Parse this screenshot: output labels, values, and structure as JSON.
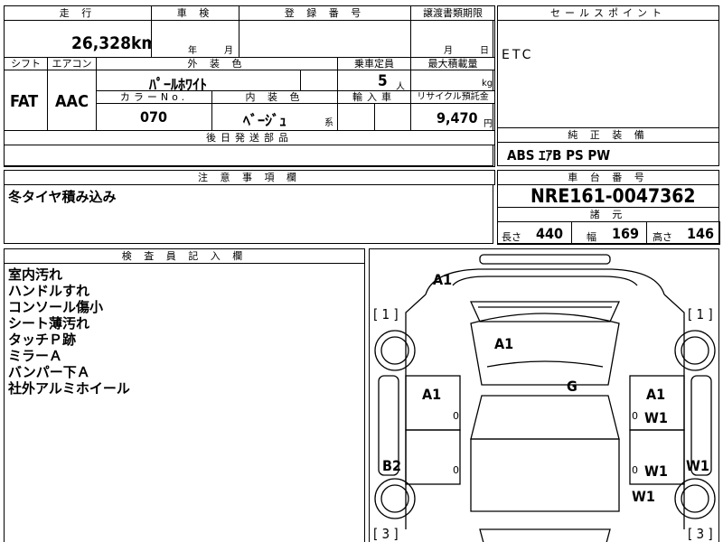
{
  "top": {
    "mileage_label": "走 行",
    "mileage_value": "26,328",
    "mileage_unit": "km",
    "inspection_label": "車 検",
    "inspection_year_unit": "年",
    "inspection_month_unit": "月",
    "registration_label": "登 録 番 号",
    "transfer_label": "譲渡書類期限",
    "transfer_month_unit": "月",
    "transfer_day_unit": "日",
    "sales_point_label": "セールスポイント",
    "sales_point_value": "ETC"
  },
  "row2": {
    "shift_label": "シフト",
    "shift_value": "FAT",
    "aircon_label": "エアコン",
    "aircon_value": "AAC",
    "exterior_label": "外 装 色",
    "exterior_value": "ﾊﾟｰﾙﾎﾜｲﾄ",
    "capacity_label": "乗車定員",
    "capacity_value": "5",
    "capacity_unit": "人",
    "load_label": "最大積載量",
    "load_unit": "kg",
    "color_no_label": "カラーNo.",
    "color_no_value": "070",
    "interior_label": "内 装 色",
    "interior_value": "ﾍﾞｰｼﾞｭ",
    "interior_suffix": "系",
    "import_label": "輸入車",
    "recycle_label": "リサイクル預託金",
    "recycle_value": "9,470",
    "recycle_unit": "円",
    "later_parts_label": "後日発送部品",
    "equipment_label": "純 正 装 備",
    "equipment_value": "ABS ｴｱB PS PW"
  },
  "notes": {
    "caution_label": "注 意 事 項 欄",
    "caution_value": "冬タイヤ積み込み",
    "chassis_label": "車 台 番 号",
    "chassis_value": "NRE161-0047362",
    "spec_label": "諸 元",
    "length_label": "長さ",
    "length_value": "440",
    "width_label": "幅",
    "width_value": "169",
    "height_label": "高さ",
    "height_value": "146"
  },
  "inspector": {
    "label": "検 査 員 記 入 欄",
    "lines": [
      "室内汚れ",
      "ハンドルすれ",
      "コンソール傷小",
      "シート薄汚れ",
      "タッチＰ跡",
      "ミラーＡ",
      "バンパー下Ａ",
      "社外アルミホイール"
    ]
  },
  "diagram": {
    "marks": [
      "A1",
      "A1",
      "G",
      "A1",
      "A1",
      "W1",
      "B2",
      "W1",
      "W1",
      "W1"
    ],
    "bracket_marks": [
      "[ 1 ]",
      "[ 1 ]",
      "[ 3 ]",
      "[ 3 ]"
    ],
    "zero_marks": [
      "0",
      "0",
      "0",
      "0"
    ]
  }
}
